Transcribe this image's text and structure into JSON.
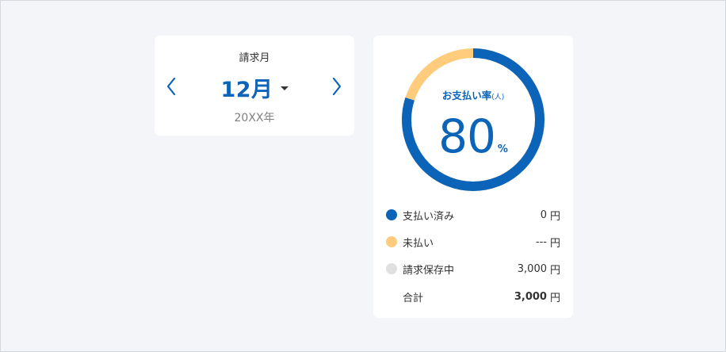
{
  "month_selector": {
    "label": "請求月",
    "month": "12月",
    "year": "20XX年",
    "prev_icon": "chevron-left-icon",
    "next_icon": "chevron-right-icon",
    "dropdown_icon": "caret-down-icon"
  },
  "payment_rate": {
    "title": "お支払い率",
    "title_unit": "(人)",
    "value": "80",
    "percent_sign": "%",
    "rate_fraction": 0.8
  },
  "breakdown": {
    "currency": "円",
    "items": [
      {
        "label": "支払い済み",
        "amount": "0",
        "color": "#0b64b8"
      },
      {
        "label": "未払い",
        "amount": "---",
        "color": "#ffcb7d"
      },
      {
        "label": "請求保存中",
        "amount": "3,000",
        "color": "#e0e0e0"
      }
    ],
    "total": {
      "label": "合計",
      "amount": "3,000"
    }
  },
  "colors": {
    "accent": "#0b64b8",
    "unpaid": "#ffcb7d",
    "pending": "#e0e0e0",
    "background": "#f3f5f8"
  }
}
